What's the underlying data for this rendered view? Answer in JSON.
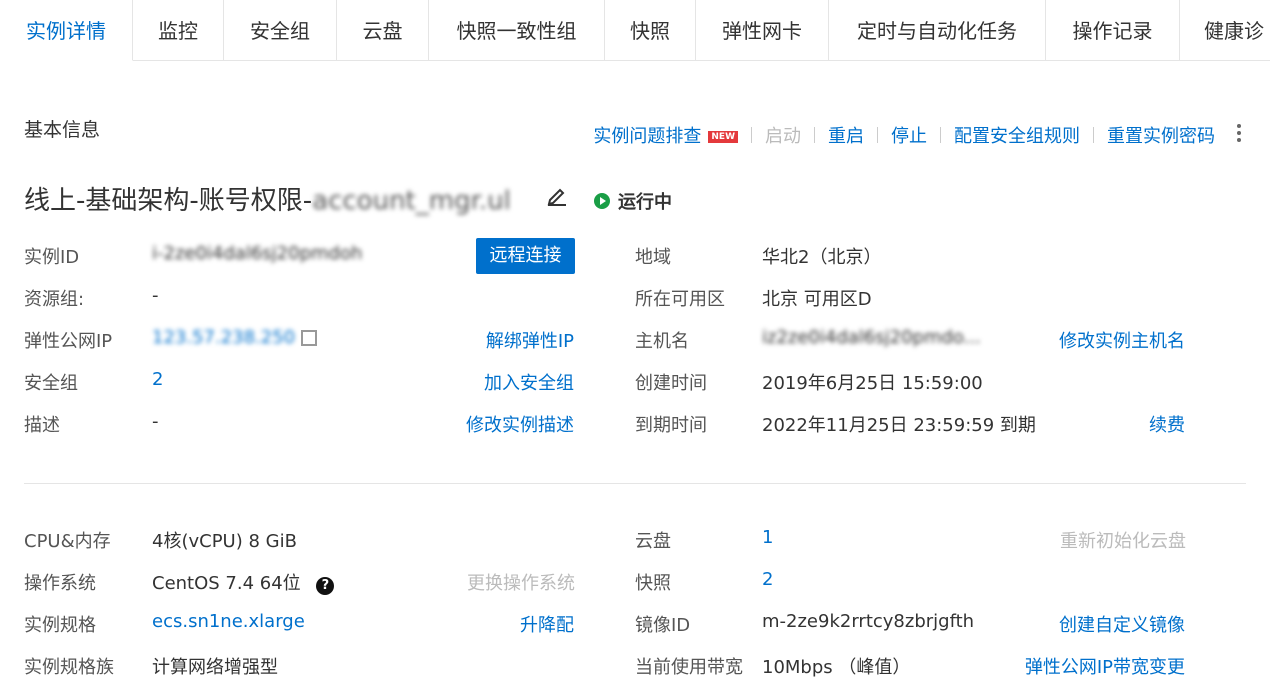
{
  "tabs": [
    {
      "label": "实例详情"
    },
    {
      "label": "监控"
    },
    {
      "label": "安全组"
    },
    {
      "label": "云盘"
    },
    {
      "label": "快照一致性组"
    },
    {
      "label": "快照"
    },
    {
      "label": "弹性网卡"
    },
    {
      "label": "定时与自动化任务"
    },
    {
      "label": "操作记录"
    },
    {
      "label": "健康诊"
    }
  ],
  "section": {
    "title": "基本信息"
  },
  "actions": {
    "troubleshoot": "实例问题排查",
    "new_badge": "NEW",
    "start": "启动",
    "restart": "重启",
    "stop": "停止",
    "config_sg": "配置安全组规则",
    "reset_pwd": "重置实例密码"
  },
  "instance": {
    "name_prefix": "线上-基础架构-账号权限-",
    "name_redacted": "account_mgr.ul",
    "status": "运行中"
  },
  "left_fields": {
    "id_label": "实例ID",
    "id_value": "i-2ze0i4dal6sj20pmdoh",
    "remote_btn": "远程连接",
    "rg_label": "资源组:",
    "rg_value": "-",
    "eip_label": "弹性公网IP",
    "eip_value": "123.57.238.250",
    "unbind_eip": "解绑弹性IP",
    "sg_label": "安全组",
    "sg_value": "2",
    "join_sg": "加入安全组",
    "desc_label": "描述",
    "desc_value": "-",
    "edit_desc": "修改实例描述"
  },
  "right_fields": {
    "region_label": "地域",
    "region_value": "华北2（北京）",
    "zone_label": "所在可用区",
    "zone_value": "北京 可用区D",
    "host_label": "主机名",
    "host_value": "iz2ze0i4dal6sj20pmdo...",
    "edit_host": "修改实例主机名",
    "created_label": "创建时间",
    "created_value": "2019年6月25日 15:59:00",
    "expire_label": "到期时间",
    "expire_value": "2022年11月25日 23:59:59 到期",
    "renew": "续费"
  },
  "config_left": {
    "cpu_label": "CPU&内存",
    "cpu_value": "4核(vCPU) 8 GiB",
    "os_label": "操作系统",
    "os_value": "CentOS 7.4 64位",
    "change_os": "更换操作系统",
    "spec_label": "实例规格",
    "spec_value": "ecs.sn1ne.xlarge",
    "upgrade": "升降配",
    "family_label": "实例规格族",
    "family_value": "计算网络增强型"
  },
  "config_right": {
    "disk_label": "云盘",
    "disk_value": "1",
    "reinit_disk": "重新初始化云盘",
    "snap_label": "快照",
    "snap_value": "2",
    "image_label": "镜像ID",
    "image_value": "m-2ze9k2rrtcy8zbrjgfth",
    "create_image": "创建自定义镜像",
    "bw_label": "当前使用带宽",
    "bw_value": "10Mbps （峰值）",
    "bw_change": "弹性公网IP带宽变更"
  }
}
